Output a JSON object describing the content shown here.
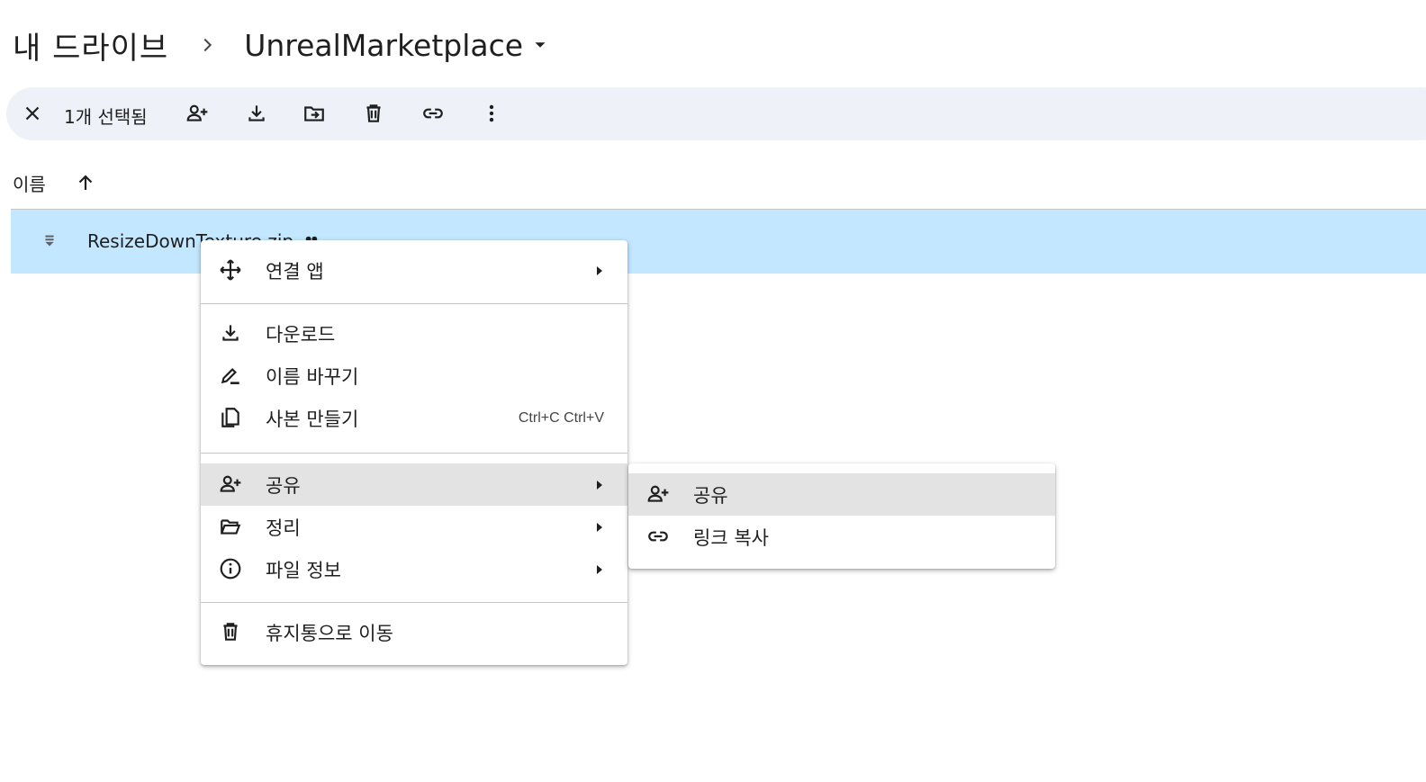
{
  "breadcrumb": {
    "root": "내 드라이브",
    "current": "UnrealMarketplace"
  },
  "toolbar": {
    "selected_count": "1개 선택됨",
    "icons": [
      "close-icon",
      "person-add-icon",
      "download-icon",
      "move-to-folder-icon",
      "trash-icon",
      "link-icon",
      "more-vert-icon"
    ]
  },
  "list": {
    "column_name": "이름",
    "rows": [
      {
        "name": "ResizeDownTexture.zip",
        "icon": "zip-file-icon",
        "shared": true
      }
    ]
  },
  "context_menu": {
    "items": [
      {
        "label": "연결 앱",
        "icon": "open-with-icon",
        "submenu": true
      },
      {
        "label": "다운로드",
        "icon": "download-icon"
      },
      {
        "label": "이름 바꾸기",
        "icon": "rename-icon"
      },
      {
        "label": "사본 만들기",
        "icon": "copy-icon",
        "shortcut": "Ctrl+C Ctrl+V"
      },
      {
        "label": "공유",
        "icon": "person-add-icon",
        "submenu": true,
        "active": true
      },
      {
        "label": "정리",
        "icon": "folder-open-icon",
        "submenu": true
      },
      {
        "label": "파일 정보",
        "icon": "info-icon",
        "submenu": true
      },
      {
        "label": "휴지통으로 이동",
        "icon": "trash-icon"
      }
    ]
  },
  "share_submenu": {
    "items": [
      {
        "label": "공유",
        "icon": "person-add-icon",
        "active": true
      },
      {
        "label": "링크 복사",
        "icon": "link-icon"
      }
    ]
  },
  "colors": {
    "selected_row": "#c2e7ff",
    "toolbar_bg": "#eef1f7",
    "menu_hover": "#e3e3e3",
    "text": "#1f1f1f"
  }
}
